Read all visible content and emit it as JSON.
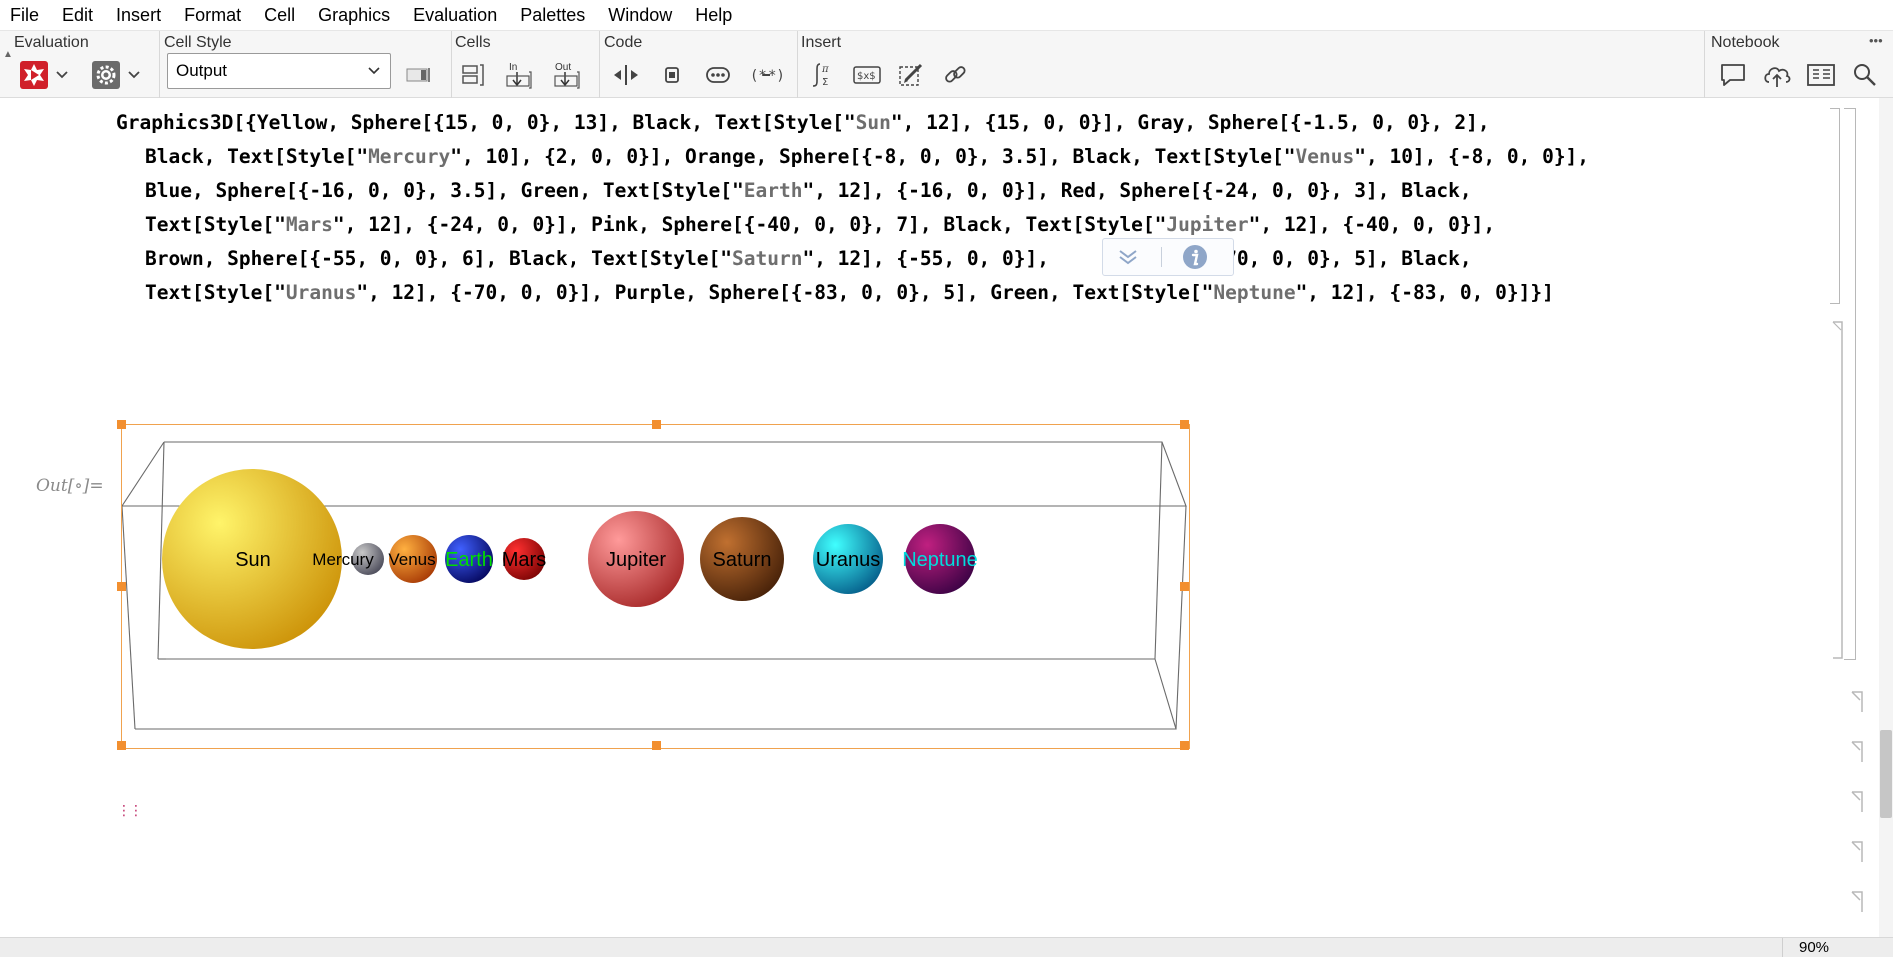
{
  "menubar": {
    "items": [
      "File",
      "Edit",
      "Insert",
      "Format",
      "Cell",
      "Graphics",
      "Evaluation",
      "Palettes",
      "Window",
      "Help"
    ]
  },
  "toolbar": {
    "evaluation": {
      "label": "Evaluation"
    },
    "cell_style": {
      "label": "Cell Style",
      "value": "Output"
    },
    "cells": {
      "label": "Cells",
      "in_label": "In",
      "out_label": "Out"
    },
    "code": {
      "label": "Code"
    },
    "insert": {
      "label": "Insert"
    },
    "notebook": {
      "label": "Notebook"
    },
    "more_label": "•••"
  },
  "input_cell": {
    "lines": [
      [
        [
          "Graphics3D[{Yellow, Sphere[{15, 0, 0}, 13], Black, Text[Style[\"",
          "c"
        ],
        [
          "Sun",
          "s"
        ],
        [
          "\", 12], {15, 0, 0}], Gray, Sphere[{-1.5, 0, 0}, 2],",
          "c"
        ]
      ],
      [
        [
          "Black, Text[Style[\"",
          "c"
        ],
        [
          "Mercury",
          "s"
        ],
        [
          "\", 10], {2, 0, 0}], Orange, Sphere[{-8, 0, 0}, 3.5], Black, Text[Style[\"",
          "c"
        ],
        [
          "Venus",
          "s"
        ],
        [
          "\", 10], {-8, 0, 0}],",
          "c"
        ]
      ],
      [
        [
          "Blue, Sphere[{-16, 0, 0}, 3.5], Green, Text[Style[\"",
          "c"
        ],
        [
          "Earth",
          "s"
        ],
        [
          "\", 12], {-16, 0, 0}], Red, Sphere[{-24, 0, 0}, 3], Black,",
          "c"
        ]
      ],
      [
        [
          "Text[Style[\"",
          "c"
        ],
        [
          "Mars",
          "s"
        ],
        [
          "\", 12], {-24, 0, 0}], Pink, Sphere[{-40, 0, 0}, 7], Black, Text[Style[\"",
          "c"
        ],
        [
          "Jupiter",
          "s"
        ],
        [
          "\", 12], {-40, 0, 0}],",
          "c"
        ]
      ],
      [
        [
          "Brown, Sphere[{-55, 0, 0}, 6], Black, Text[Style[\"",
          "c"
        ],
        [
          "Saturn",
          "s"
        ],
        [
          "\", 12], {-55, 0, 0}],",
          "c"
        ],
        [
          "          ",
          "c"
        ],
        [
          "re[{-70, 0, 0}, 5], Black,",
          "c"
        ]
      ],
      [
        [
          "Text[Style[\"",
          "c"
        ],
        [
          "Uranus",
          "s"
        ],
        [
          "\", 12], {-70, 0, 0}], Purple, Sphere[{-83, 0, 0}, 5], Green, Text[Style[\"",
          "c"
        ],
        [
          "Neptune",
          "s"
        ],
        [
          "\", 12], {-83, 0, 0}]}]",
          "c"
        ]
      ]
    ]
  },
  "output": {
    "label": "Out[∘]=",
    "planets": [
      {
        "name": "Sun",
        "color_light": "#fff46a",
        "color_dark": "#c88a00",
        "label_color": "#000000"
      },
      {
        "name": "Mercury",
        "color_light": "#c8c8c8",
        "color_dark": "#404050",
        "label_color": "#000000"
      },
      {
        "name": "Venus",
        "color_light": "#ffb040",
        "color_dark": "#a03000",
        "label_color": "#000000"
      },
      {
        "name": "Earth",
        "color_light": "#4060ff",
        "color_dark": "#000050",
        "label_color": "#00dd00"
      },
      {
        "name": "Mars",
        "color_light": "#ff3030",
        "color_dark": "#700000",
        "label_color": "#000000"
      },
      {
        "name": "Jupiter",
        "color_light": "#ff9a9a",
        "color_dark": "#a02020",
        "label_color": "#000000"
      },
      {
        "name": "Saturn",
        "color_light": "#c07030",
        "color_dark": "#3c1a05",
        "label_color": "#000000"
      },
      {
        "name": "Uranus",
        "color_light": "#40ffff",
        "color_dark": "#005080",
        "label_color": "#000000"
      },
      {
        "name": "Neptune",
        "color_light": "#c02080",
        "color_dark": "#300040",
        "label_color": "#00dddd"
      }
    ]
  },
  "statusbar": {
    "zoom": "90%"
  },
  "colors": {
    "selection": "#f0a24e",
    "handle": "#f28f2f",
    "string": "#6e6e6e"
  }
}
